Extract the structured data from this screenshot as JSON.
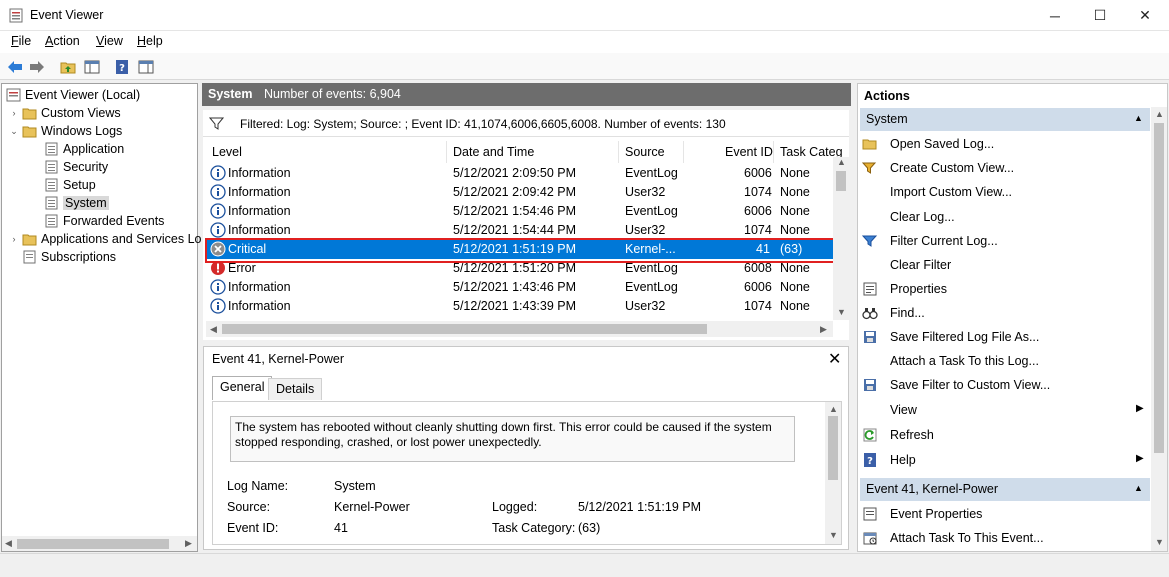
{
  "window": {
    "title": "Event Viewer",
    "controls": {
      "minimize": "─",
      "maximize": "☐",
      "close": "✕"
    }
  },
  "menu": [
    {
      "label": "File",
      "accel": "F",
      "rest": "ile"
    },
    {
      "label": "Action",
      "accel": "A",
      "rest": "ction"
    },
    {
      "label": "View",
      "accel": "V",
      "rest": "iew"
    },
    {
      "label": "Help",
      "accel": "H",
      "rest": "elp"
    }
  ],
  "tree": {
    "items": [
      {
        "label": "Event Viewer (Local)",
        "icon": "event-viewer-icon"
      },
      {
        "label": "Custom Views",
        "icon": "folder-icon",
        "toggle": "›"
      },
      {
        "label": "Windows Logs",
        "icon": "folder-icon",
        "toggle": "⌄"
      },
      {
        "label": "Application",
        "icon": "log-icon"
      },
      {
        "label": "Security",
        "icon": "log-icon"
      },
      {
        "label": "Setup",
        "icon": "log-icon"
      },
      {
        "label": "System",
        "icon": "log-icon",
        "selected": true
      },
      {
        "label": "Forwarded Events",
        "icon": "log-icon"
      },
      {
        "label": "Applications and Services Lo",
        "icon": "folder-icon",
        "toggle": "›"
      },
      {
        "label": "Subscriptions",
        "icon": "subscriptions-icon"
      }
    ]
  },
  "middle": {
    "title": "System",
    "count": "Number of events: 6,904",
    "filter": "Filtered: Log: System; Source: ; Event ID: 41,1074,6006,6605,6008. Number of events: 130",
    "columns": [
      "Level",
      "Date and Time",
      "Source",
      "Event ID",
      "Task Categ"
    ],
    "rows": [
      {
        "level": "Information",
        "date": "5/12/2021 2:09:50 PM",
        "source": "EventLog",
        "id": "6006",
        "task": "None",
        "type": "info"
      },
      {
        "level": "Information",
        "date": "5/12/2021 2:09:42 PM",
        "source": "User32",
        "id": "1074",
        "task": "None",
        "type": "info"
      },
      {
        "level": "Information",
        "date": "5/12/2021 1:54:46 PM",
        "source": "EventLog",
        "id": "6006",
        "task": "None",
        "type": "info"
      },
      {
        "level": "Information",
        "date": "5/12/2021 1:54:44 PM",
        "source": "User32",
        "id": "1074",
        "task": "None",
        "type": "info"
      },
      {
        "level": "Critical",
        "date": "5/12/2021 1:51:19 PM",
        "source": "Kernel-...",
        "id": "41",
        "task": "(63)",
        "type": "critical",
        "selected": true
      },
      {
        "level": "Error",
        "date": "5/12/2021 1:51:20 PM",
        "source": "EventLog",
        "id": "6008",
        "task": "None",
        "type": "error"
      },
      {
        "level": "Information",
        "date": "5/12/2021 1:43:46 PM",
        "source": "EventLog",
        "id": "6006",
        "task": "None",
        "type": "info"
      },
      {
        "level": "Information",
        "date": "5/12/2021 1:43:39 PM",
        "source": "User32",
        "id": "1074",
        "task": "None",
        "type": "info"
      }
    ]
  },
  "detail": {
    "title": "Event 41, Kernel-Power",
    "tabs": [
      "General",
      "Details"
    ],
    "description": "The system has rebooted without cleanly shutting down first. This error could be caused if the system stopped responding, crashed, or lost power unexpectedly.",
    "fields": {
      "log_name_label": "Log Name:",
      "log_name": "System",
      "source_label": "Source:",
      "source": "Kernel-Power",
      "logged_label": "Logged:",
      "logged": "5/12/2021 1:51:19 PM",
      "event_id_label": "Event ID:",
      "event_id": "41",
      "task_label": "Task Category:",
      "task": "(63)"
    }
  },
  "actions": {
    "title": "Actions",
    "section1": "System",
    "items1": [
      {
        "label": "Open Saved Log...",
        "icon": "open-folder-icon"
      },
      {
        "label": "Create Custom View...",
        "icon": "filter-star-icon"
      },
      {
        "label": "Import Custom View...",
        "icon": ""
      },
      {
        "label": "Clear Log...",
        "icon": ""
      },
      {
        "label": "Filter Current Log...",
        "icon": "filter-icon"
      },
      {
        "label": "Clear Filter",
        "icon": ""
      },
      {
        "label": "Properties",
        "icon": "properties-icon"
      },
      {
        "label": "Find...",
        "icon": "binoculars-icon"
      },
      {
        "label": "Save Filtered Log File As...",
        "icon": "save-icon"
      },
      {
        "label": "Attach a Task To this Log...",
        "icon": ""
      },
      {
        "label": "Save Filter to Custom View...",
        "icon": "save-filter-icon"
      },
      {
        "label": "View",
        "icon": "",
        "submenu": "▶"
      },
      {
        "label": "Refresh",
        "icon": "refresh-icon"
      },
      {
        "label": "Help",
        "icon": "help-icon",
        "submenu": "▶"
      }
    ],
    "section2": "Event 41, Kernel-Power",
    "items2": [
      {
        "label": "Event Properties",
        "icon": "event-properties-icon"
      },
      {
        "label": "Attach Task To This Event...",
        "icon": "task-icon"
      }
    ],
    "collapse_glyph": "▲"
  },
  "colors": {
    "selection": "#0078d7",
    "highlight_border": "#e02020",
    "section_bg": "#cfdcea"
  }
}
